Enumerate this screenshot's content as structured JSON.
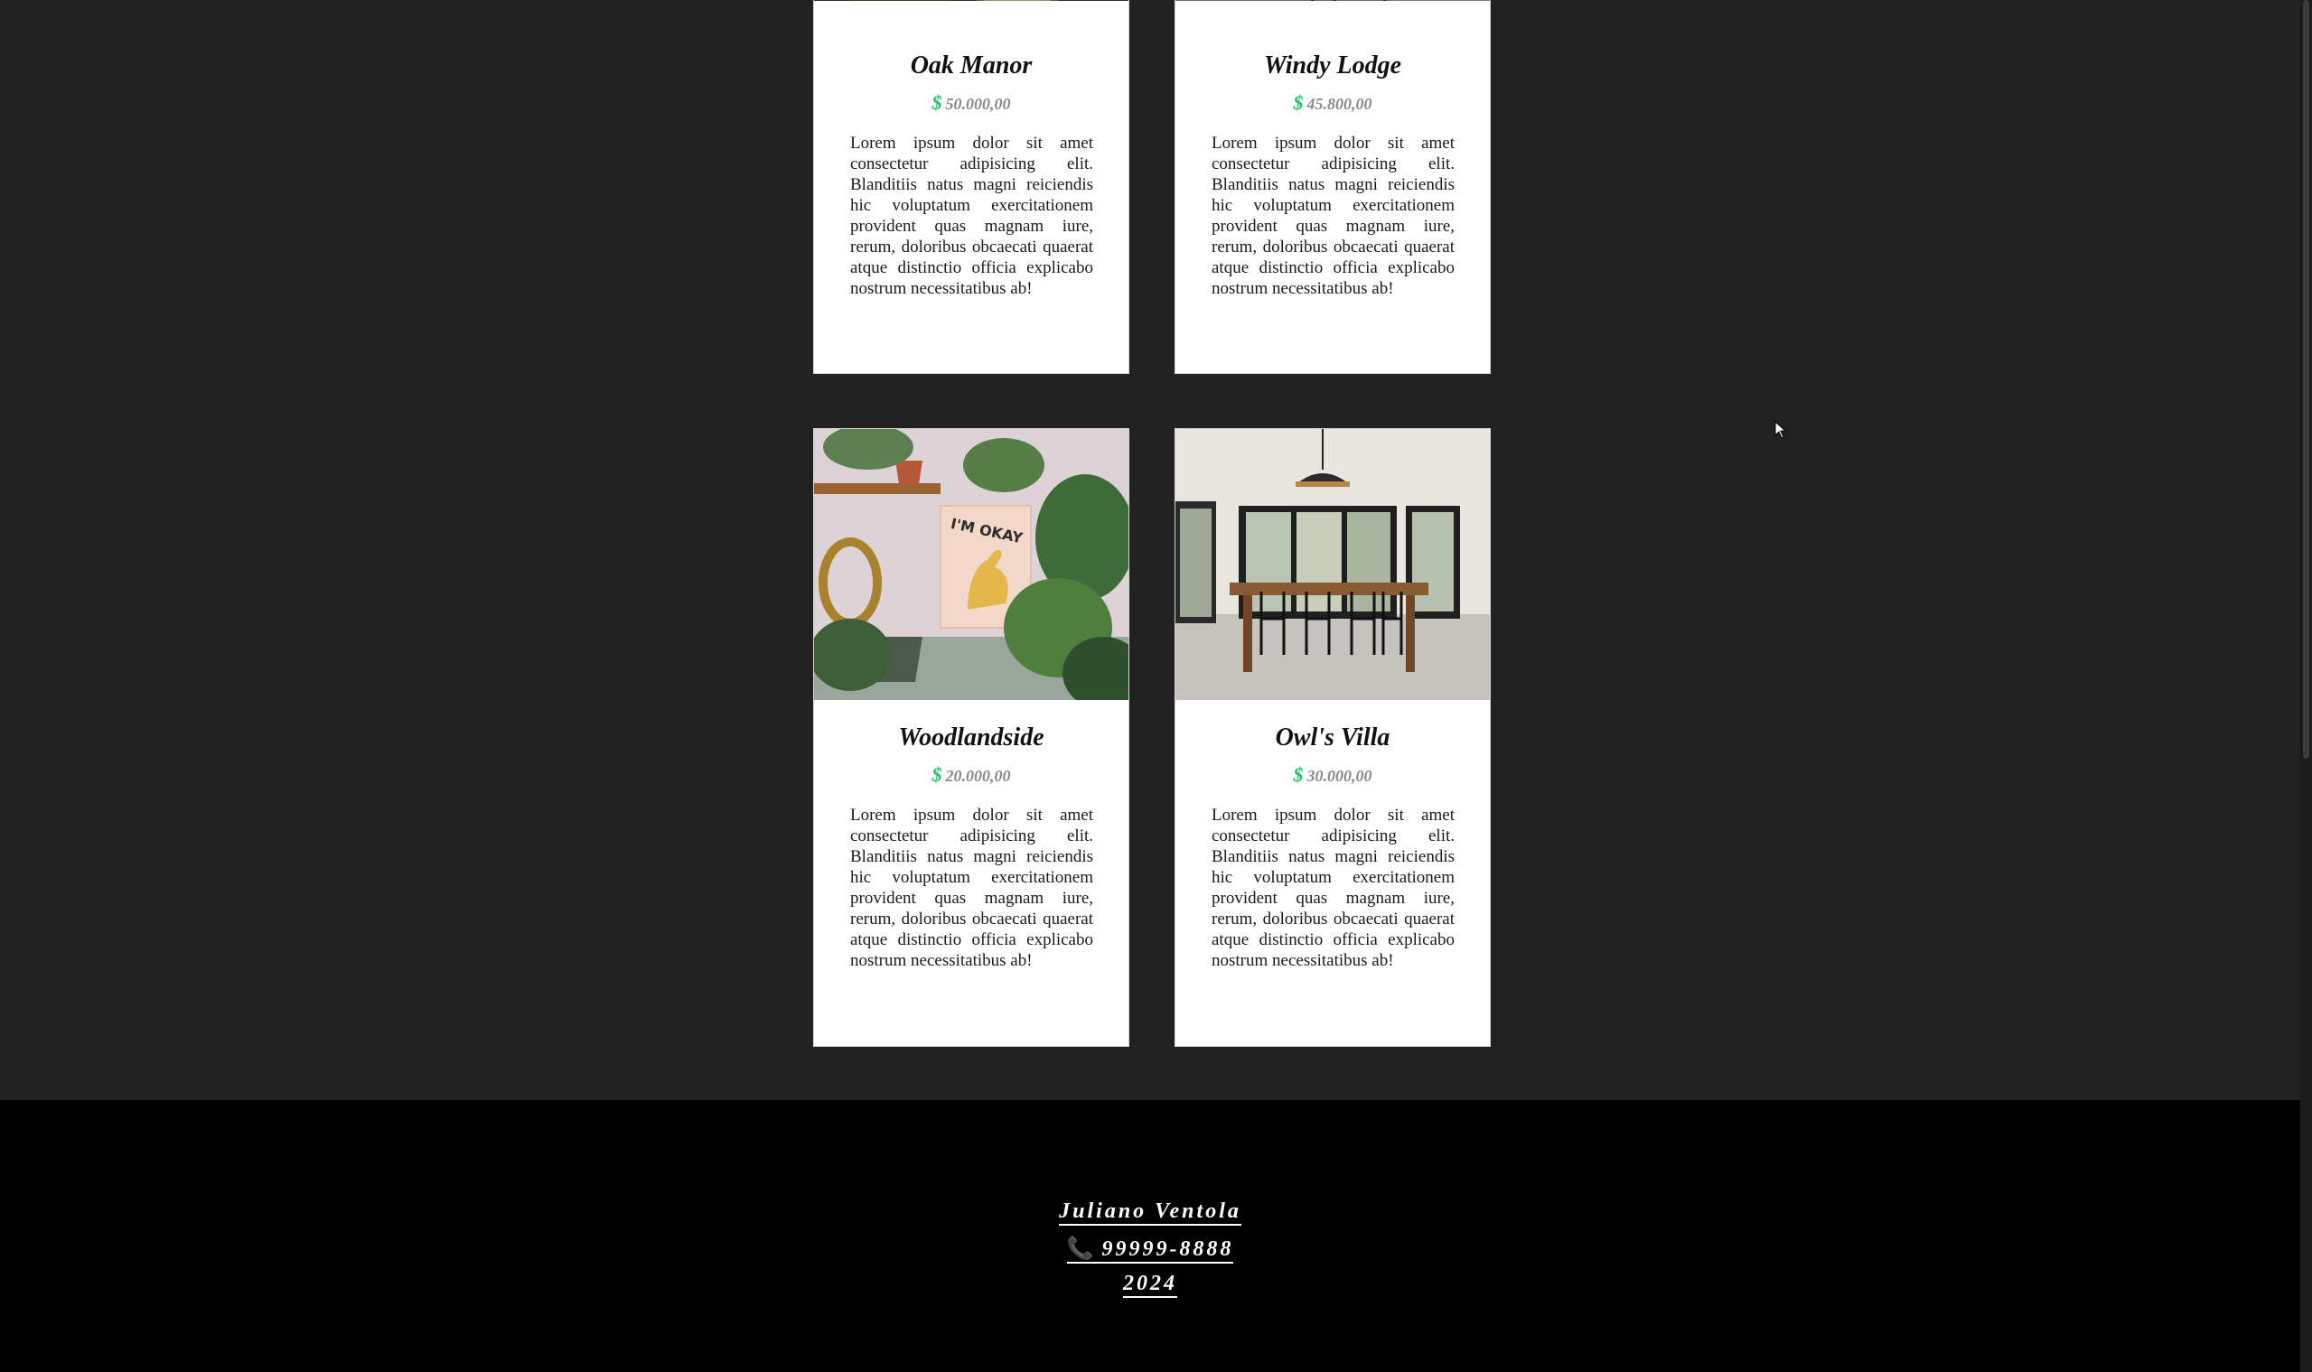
{
  "listings": [
    {
      "title": "Oak Manor",
      "currency_icon": "dollar-icon",
      "price": "50.000,00",
      "description": "Lorem ipsum dolor sit amet consectetur adipisicing elit. Blanditiis natus magni reiciendis hic voluptatum exercitationem provident quas magnam iure, rerum, doloribus obcaecati quaerat atque distinctio officia explicabo nostrum necessitatibus ab!"
    },
    {
      "title": "Windy Lodge",
      "currency_icon": "dollar-icon",
      "price": "45.800,00",
      "description": "Lorem ipsum dolor sit amet consectetur adipisicing elit. Blanditiis natus magni reiciendis hic voluptatum exercitationem provident quas magnam iure, rerum, doloribus obcaecati quaerat atque distinctio officia explicabo nostrum necessitatibus ab!"
    },
    {
      "title": "Woodlandside",
      "currency_icon": "dollar-icon",
      "price": "20.000,00",
      "description": "Lorem ipsum dolor sit amet consectetur adipisicing elit. Blanditiis natus magni reiciendis hic voluptatum exercitationem provident quas magnam iure, rerum, doloribus obcaecati quaerat atque distinctio officia explicabo nostrum necessitatibus ab!"
    },
    {
      "title": "Owl's Villa",
      "currency_icon": "dollar-icon",
      "price": "30.000,00",
      "description": "Lorem ipsum dolor sit amet consectetur adipisicing elit. Blanditiis natus magni reiciendis hic voluptatum exercitationem provident quas magnam iure, rerum, doloribus obcaecati quaerat atque distinctio officia explicabo nostrum necessitatibus ab!"
    }
  ],
  "footer": {
    "name": "Juliano Ventola",
    "phone_icon": "phone-icon",
    "phone": "99999-8888",
    "year": "2024"
  },
  "colors": {
    "page_background": "#212121",
    "footer_background": "#000000",
    "card_background": "#ffffff",
    "dollar_accent": "#22c55e",
    "phone_icon_accent": "#e11d48"
  }
}
